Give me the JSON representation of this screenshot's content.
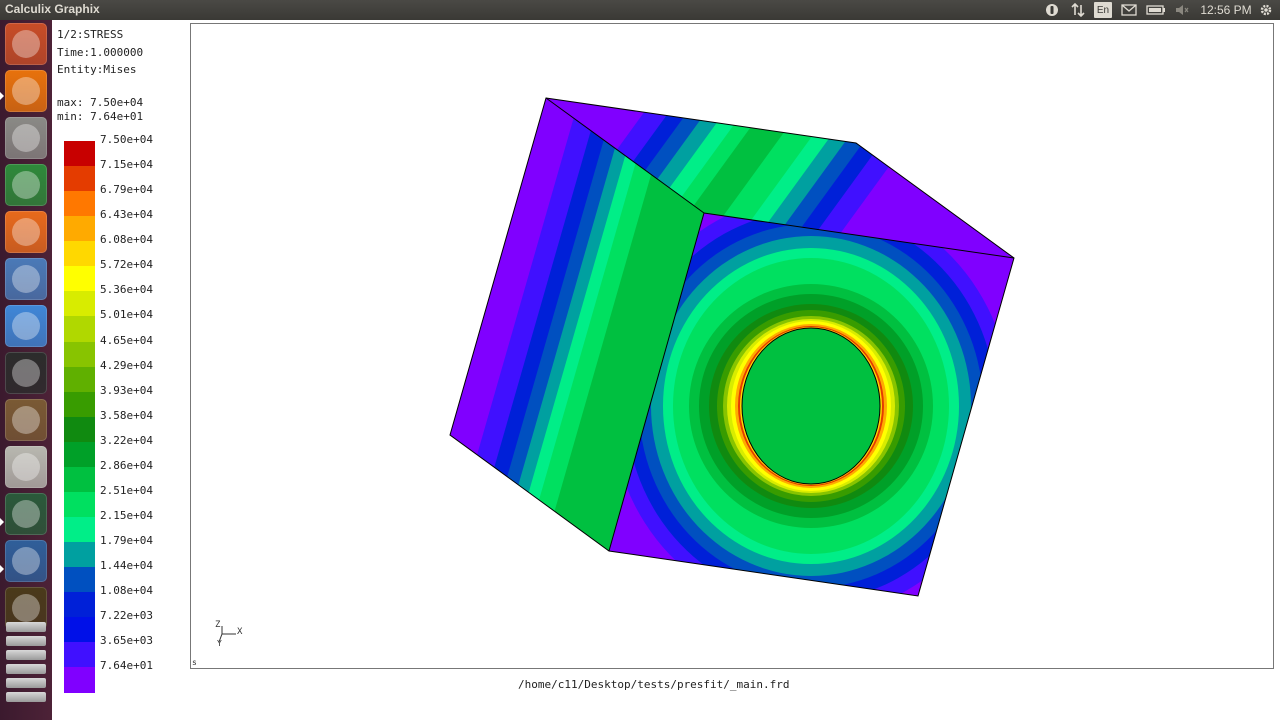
{
  "window": {
    "title": "Calculix Graphix"
  },
  "panel": {
    "clock": "12:56 PM",
    "keyboard": "En"
  },
  "launcher": {
    "items": [
      {
        "name": "dash-home",
        "color": "#c84d27"
      },
      {
        "name": "firefox",
        "color": "#e8720c"
      },
      {
        "name": "files",
        "color": "#8a8a86"
      },
      {
        "name": "libreoffice-calc",
        "color": "#2e8a3a"
      },
      {
        "name": "software-center",
        "color": "#e86a1c"
      },
      {
        "name": "system-settings",
        "color": "#4a7ab8"
      },
      {
        "name": "chrome",
        "color": "#3f87d8"
      },
      {
        "name": "terminal",
        "color": "#2c2c2c"
      },
      {
        "name": "paint",
        "color": "#7a5a34"
      },
      {
        "name": "text-editor",
        "color": "#b8b8b0"
      },
      {
        "name": "photo-viewer",
        "color": "#2a5a3a"
      },
      {
        "name": "gimp",
        "color": "#2f5f9a"
      },
      {
        "name": "xterm",
        "color": "#4a3a1a"
      }
    ]
  },
  "info": {
    "step": "1/2:STRESS",
    "time": "Time:1.000000",
    "entity": "Entity:Mises",
    "max": "max: 7.50e+04",
    "min": "min: 7.64e+01"
  },
  "legend": {
    "labels": [
      "7.50e+04",
      "7.15e+04",
      "6.79e+04",
      "6.43e+04",
      "6.08e+04",
      "5.72e+04",
      "5.36e+04",
      "5.01e+04",
      "4.65e+04",
      "4.29e+04",
      "3.93e+04",
      "3.58e+04",
      "3.22e+04",
      "2.86e+04",
      "2.51e+04",
      "2.15e+04",
      "1.79e+04",
      "1.44e+04",
      "1.08e+04",
      "7.22e+03",
      "3.65e+03",
      "7.64e+01"
    ],
    "colors": [
      "#c80000",
      "#e43c00",
      "#ff7800",
      "#ffaa00",
      "#ffd800",
      "#ffff00",
      "#d8ec00",
      "#b0d800",
      "#88c400",
      "#60b000",
      "#389c00",
      "#108a10",
      "#00a028",
      "#00c040",
      "#00e060",
      "#00ee88",
      "#00a0a0",
      "#0050c0",
      "#0020d8",
      "#0010e8",
      "#4010ff",
      "#8000ff"
    ]
  },
  "axes": {
    "x": "X",
    "z": "Z",
    "y": "Y"
  },
  "corner_marker": "s",
  "file_path": "/home/c11/Desktop/tests/presfit/_main.frd"
}
